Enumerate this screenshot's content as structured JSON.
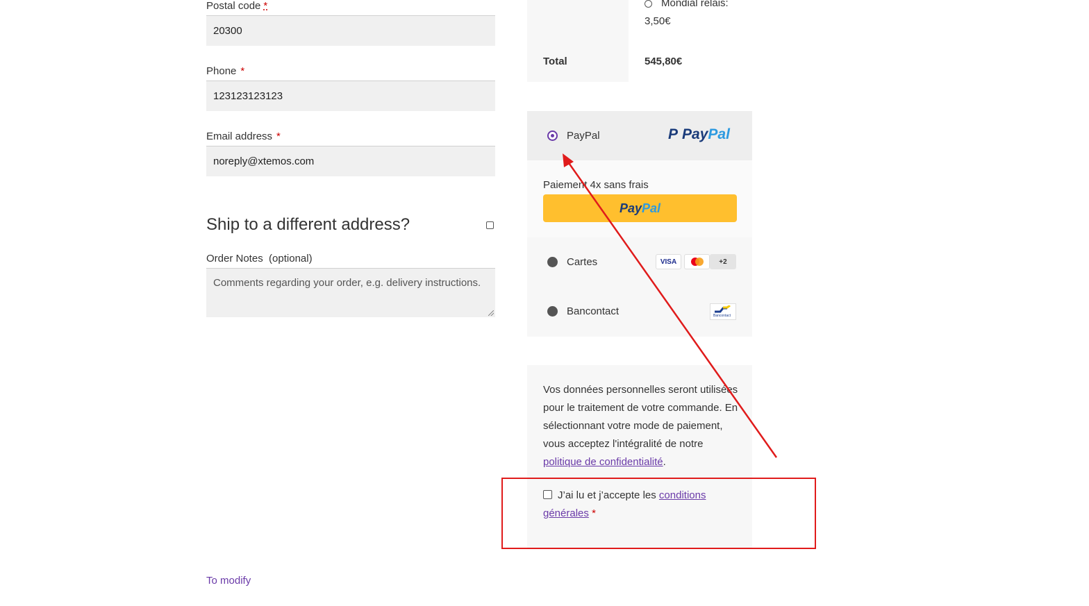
{
  "form": {
    "postal_code": {
      "label": "Postal code",
      "required_mark": "*",
      "value": "20300"
    },
    "phone": {
      "label": "Phone",
      "required_mark": "*",
      "value": "123123123123"
    },
    "email": {
      "label": "Email address",
      "required_mark": "*",
      "value": "noreply@xtemos.com"
    },
    "ship_different": {
      "title": "Ship to a different address?",
      "checked": false
    },
    "order_notes": {
      "label": "Order Notes",
      "optional": "(optional)",
      "placeholder": "Comments regarding your order, e.g. delivery instructions."
    },
    "modify_link": "To modify"
  },
  "summary": {
    "shipping_option": {
      "label": "Mondial relais:",
      "price": "3,50€"
    },
    "total_label": "Total",
    "total_value": "545,80€"
  },
  "payment": {
    "paypal": {
      "label": "PayPal",
      "logo_p": "P",
      "logo_pay": "Pay",
      "logo_pal": "Pal",
      "selected": true
    },
    "pay_in_4": "Paiement 4x sans frais",
    "paypal_button": {
      "pay": "Pay",
      "pal": "Pal"
    },
    "cards": {
      "label": "Cartes",
      "badges": [
        "VISA",
        "",
        "+2"
      ]
    },
    "bancontact": {
      "label": "Bancontact",
      "logo_text": "Bancontact"
    }
  },
  "privacy": {
    "text": "Vos données personnelles seront utilisées pour le traitement de votre commande. En sélectionnant votre mode de paiement, vous acceptez l'intégralité de notre",
    "link": "politique de confidentialité",
    "end": "."
  },
  "terms": {
    "text": "J’ai lu et j’accepte les",
    "link": "conditions générales",
    "required_mark": "*"
  },
  "colors": {
    "accent": "#6a3aa8",
    "annotation_red": "#e01b1b",
    "paypal_button": "#ffbf2e"
  }
}
